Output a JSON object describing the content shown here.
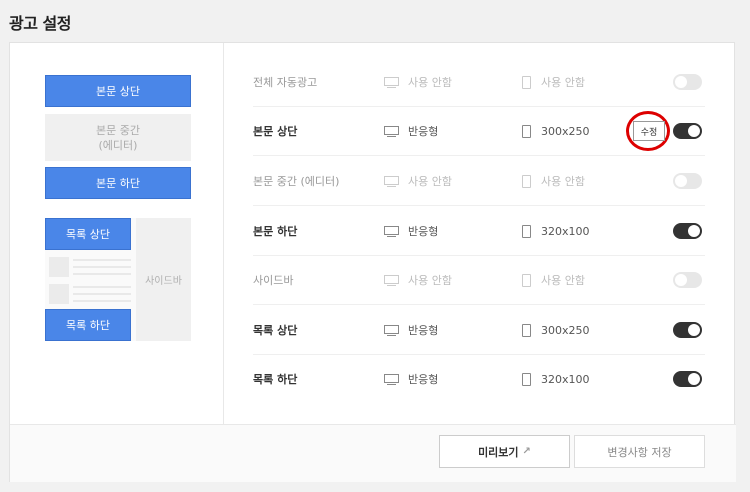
{
  "page": {
    "title": "광고 설정"
  },
  "preview": {
    "body_top": "본문 상단",
    "body_mid": "본문 중간\n(에디터)",
    "body_bottom": "본문 하단",
    "list_top": "목록 상단",
    "list_bottom": "목록 하단",
    "sidebar": "사이드바"
  },
  "rows": [
    {
      "label": "전체 자동광고",
      "enabled": false,
      "pc": "사용 안함",
      "mobile": "사용 안함",
      "edit": ""
    },
    {
      "label": "본문 상단",
      "enabled": true,
      "pc": "반응형",
      "mobile": "300x250",
      "edit": "수정"
    },
    {
      "label": "본문 중간 (에디터)",
      "enabled": false,
      "pc": "사용 안함",
      "mobile": "사용 안함",
      "edit": ""
    },
    {
      "label": "본문 하단",
      "enabled": true,
      "pc": "반응형",
      "mobile": "320x100",
      "edit": ""
    },
    {
      "label": "사이드바",
      "enabled": false,
      "pc": "사용 안함",
      "mobile": "사용 안함",
      "edit": ""
    },
    {
      "label": "목록 상단",
      "enabled": true,
      "pc": "반응형",
      "mobile": "300x250",
      "edit": ""
    },
    {
      "label": "목록 하단",
      "enabled": true,
      "pc": "반응형",
      "mobile": "320x100",
      "edit": ""
    }
  ],
  "footer": {
    "preview_label": "미리보기",
    "save_label": "변경사항 저장"
  },
  "icons": {
    "pc": "monitor-icon",
    "mobile": "phone-icon",
    "external": "external-link-icon"
  },
  "colors": {
    "accent": "#4a86e8",
    "highlight": "#dd0000",
    "toggle_on": "#333333",
    "toggle_off": "#e7e7e7"
  }
}
